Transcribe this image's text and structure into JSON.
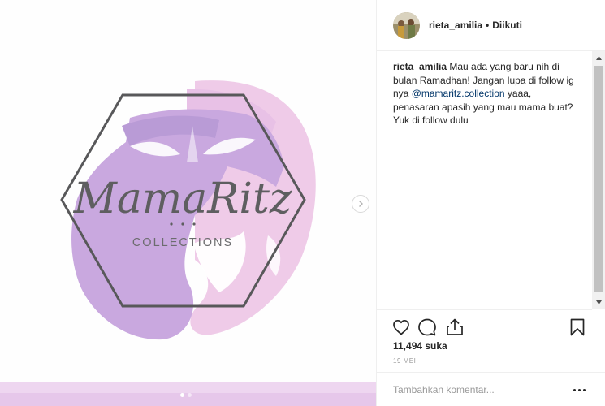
{
  "post": {
    "media": {
      "logo_script": "MamaRitz",
      "logo_sub": "COLLECTIONS",
      "next_icon": "chevron-right-icon",
      "carousel_dots": 2,
      "carousel_active": 1
    },
    "header": {
      "username": "rieta_amilia",
      "separator": "•",
      "follow_status": "Diikuti"
    },
    "caption": {
      "username": "rieta_amilia",
      "text_before": " Mau ada yang baru nih di bulan Ramadhan! Jangan lupa di follow ig nya ",
      "mention": "@mamaritz.collection",
      "text_after": " yaaa, penasaran apasih yang mau mama buat? Yuk di follow dulu"
    },
    "actions": {
      "like_icon": "heart-icon",
      "comment_icon": "comment-icon",
      "share_icon": "share-icon",
      "save_icon": "bookmark-icon"
    },
    "likes_text": "11,494 suka",
    "date_text": "19 MEI",
    "comment_input": {
      "placeholder": "Tambahkan komentar...",
      "value": ""
    }
  },
  "colors": {
    "logo_purple": "#c9a8df",
    "logo_pink": "#efcbe8",
    "hexagon_stroke": "#58585a",
    "mention_blue": "#003569"
  }
}
